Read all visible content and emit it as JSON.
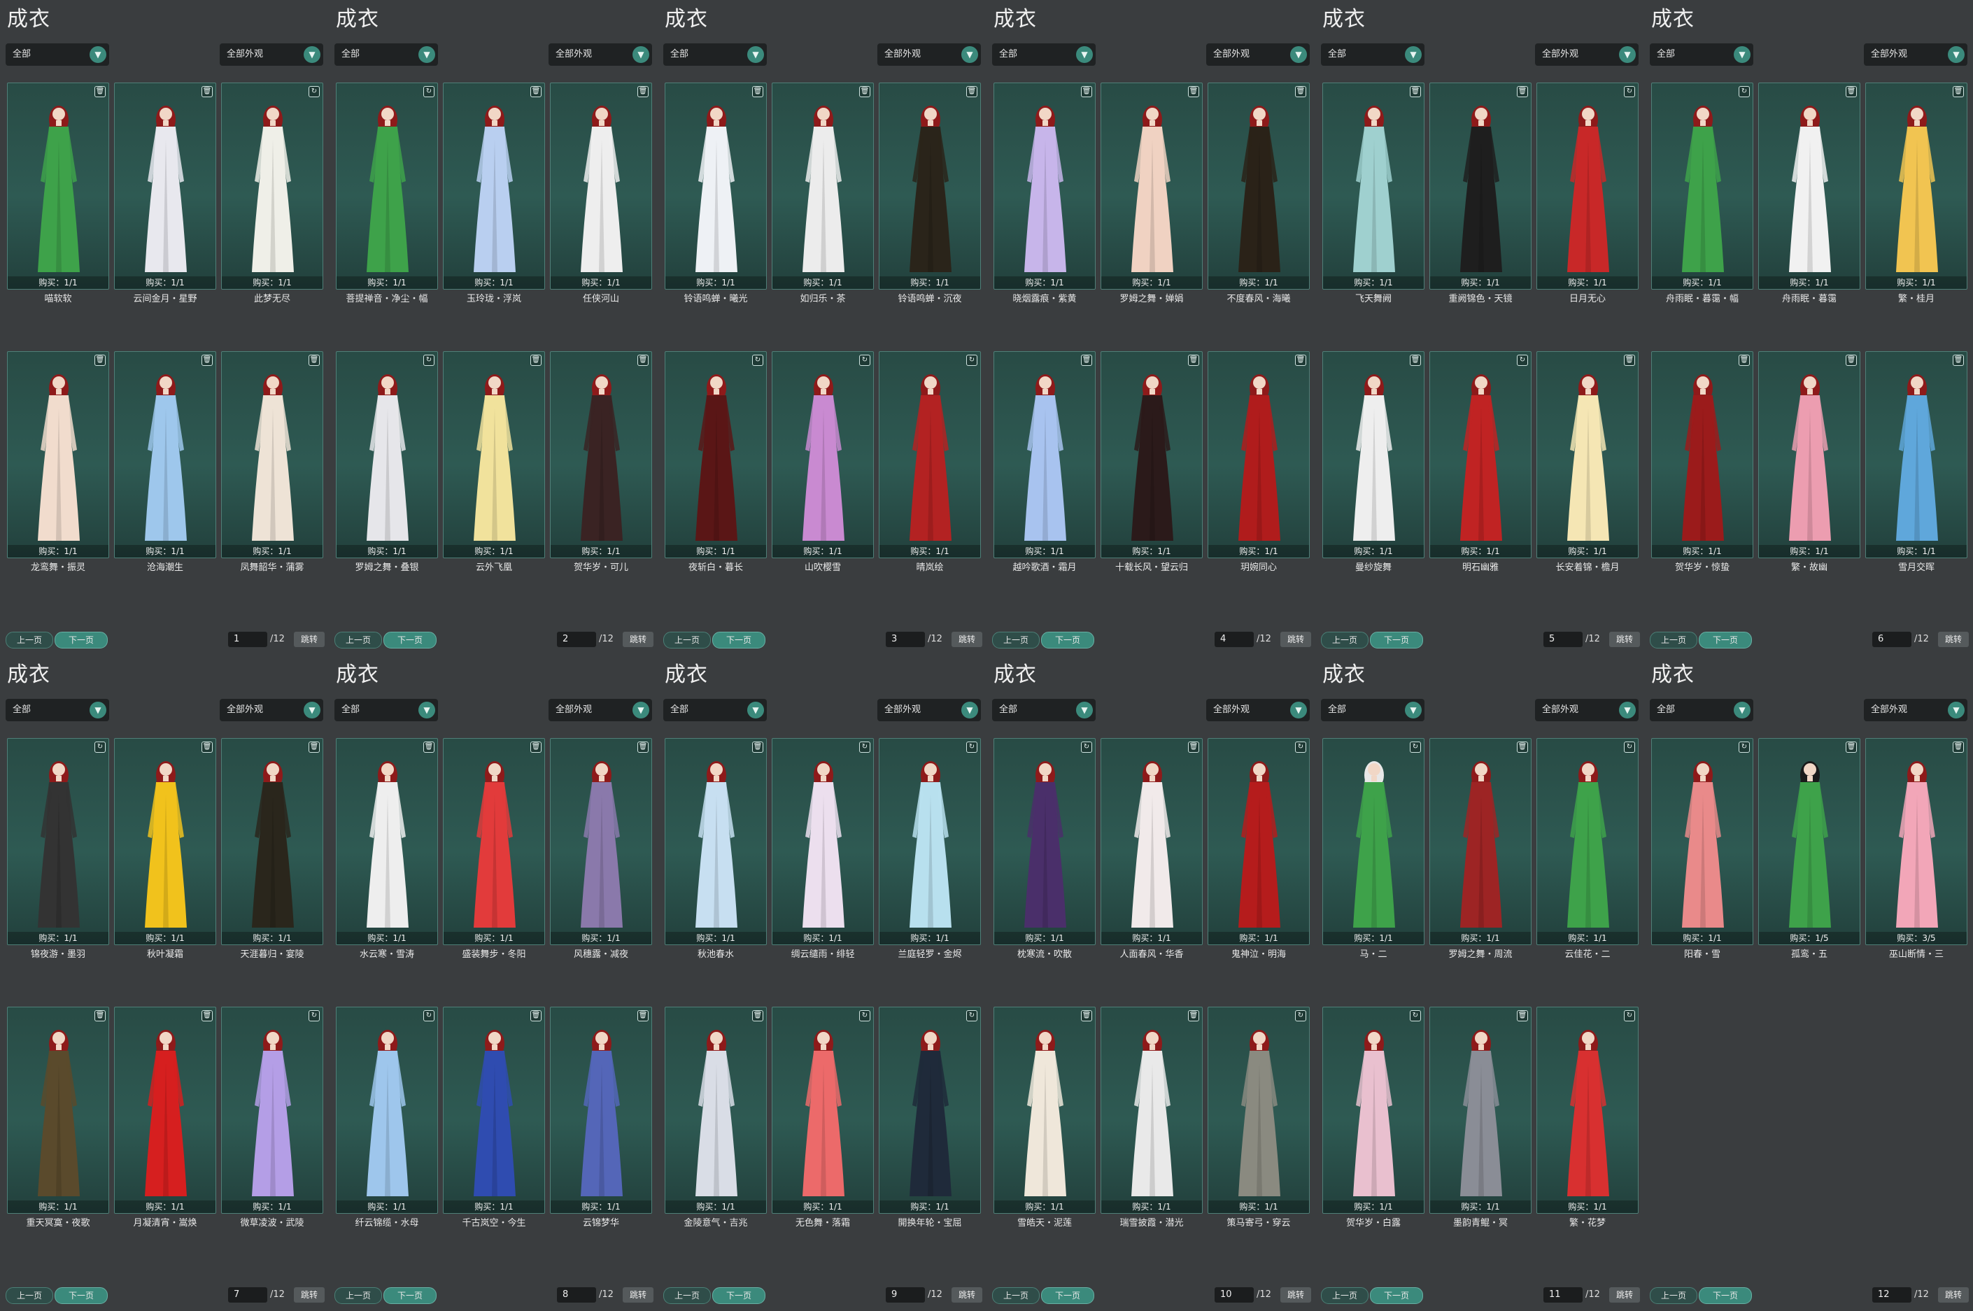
{
  "ui": {
    "title": "成衣",
    "filter_all": "全部",
    "filter_appearance": "全部外观",
    "prev": "上一页",
    "next": "下一页",
    "jump": "跳转",
    "total": "/12",
    "dropdown_icon": "chevron-down-icon"
  },
  "colors": {
    "panel_bg": "#3a3d3f",
    "card_bg": "#2e5a53",
    "accent": "#3b8a7c"
  },
  "pages": [
    {
      "page": "1",
      "items": [
        {
          "name": "喵软软",
          "buy": "购买：1/1",
          "icon": "trash-icon",
          "hair": "#8e1a1a",
          "outfit": "#3ea24a"
        },
        {
          "name": "云间金月・星野",
          "buy": "购买：1/1",
          "icon": "trash-icon",
          "hair": "#8e1a1a",
          "outfit": "#e8e8ee"
        },
        {
          "name": "此梦无尽",
          "buy": "购买：1/1",
          "icon": "refresh-icon",
          "hair": "#8e1a1a",
          "outfit": "#efefe8"
        },
        {
          "name": "龙鸾舞・振灵",
          "buy": "购买：1/1",
          "icon": "trash-icon",
          "hair": "#8e1a1a",
          "outfit": "#f1dccd"
        },
        {
          "name": "沧海潮生",
          "buy": "购买：1/1",
          "icon": "trash-icon",
          "hair": "#8e1a1a",
          "outfit": "#9ec7ec"
        },
        {
          "name": "凤舞韶华・蒲雾",
          "buy": "购买：1/1",
          "icon": "trash-icon",
          "hair": "#8e1a1a",
          "outfit": "#eee3d6"
        }
      ]
    },
    {
      "page": "2",
      "items": [
        {
          "name": "菩提禅音・净尘・幅",
          "buy": "购买：1/1",
          "icon": "refresh-icon",
          "hair": "#8e1a1a",
          "outfit": "#3ea24a"
        },
        {
          "name": "玉玲珑・浮岚",
          "buy": "购买：1/1",
          "icon": "trash-icon",
          "hair": "#8e1a1a",
          "outfit": "#b9cff0"
        },
        {
          "name": "任侠河山",
          "buy": "购买：1/1",
          "icon": "trash-icon",
          "hair": "#8e1a1a",
          "outfit": "#eeeeee"
        },
        {
          "name": "罗姆之舞・叠银",
          "buy": "购买：1/1",
          "icon": "refresh-icon",
          "hair": "#8e1a1a",
          "outfit": "#e6e6ea"
        },
        {
          "name": "云外飞凰",
          "buy": "购买：1/1",
          "icon": "trash-icon",
          "hair": "#8e1a1a",
          "outfit": "#f1e29c"
        },
        {
          "name": "贺华岁・可儿",
          "buy": "购买：1/1",
          "icon": "trash-icon",
          "hair": "#8e1a1a",
          "outfit": "#3a2323"
        }
      ]
    },
    {
      "page": "3",
      "items": [
        {
          "name": "铃语鸣蝉・曦光",
          "buy": "购买：1/1",
          "icon": "trash-icon",
          "hair": "#8e1a1a",
          "outfit": "#eef1f5"
        },
        {
          "name": "如归乐・茶",
          "buy": "购买：1/1",
          "icon": "trash-icon",
          "hair": "#8e1a1a",
          "outfit": "#ececec"
        },
        {
          "name": "铃语鸣蝉・沉夜",
          "buy": "购买：1/1",
          "icon": "trash-icon",
          "hair": "#8e1a1a",
          "outfit": "#2a241a"
        },
        {
          "name": "夜斩白・暮长",
          "buy": "购买：1/1",
          "icon": "refresh-icon",
          "hair": "#8e1a1a",
          "outfit": "#5a1616"
        },
        {
          "name": "山吹樱雪",
          "buy": "购买：1/1",
          "icon": "refresh-icon",
          "hair": "#8e1a1a",
          "outfit": "#c98ad1"
        },
        {
          "name": "晴岚绘",
          "buy": "购买：1/1",
          "icon": "refresh-icon",
          "hair": "#8e1a1a",
          "outfit": "#b32222"
        }
      ]
    },
    {
      "page": "4",
      "items": [
        {
          "name": "晓烟露痕・紫黄",
          "buy": "购买：1/1",
          "icon": "trash-icon",
          "hair": "#8e1a1a",
          "outfit": "#c7b5ea"
        },
        {
          "name": "罗姆之舞・婵娟",
          "buy": "购买：1/1",
          "icon": "trash-icon",
          "hair": "#8e1a1a",
          "outfit": "#f0d2c2"
        },
        {
          "name": "不度春风・海曦",
          "buy": "购买：1/1",
          "icon": "trash-icon",
          "hair": "#8e1a1a",
          "outfit": "#2a2218"
        },
        {
          "name": "越吟歌酒・霜月",
          "buy": "购买：1/1",
          "icon": "trash-icon",
          "hair": "#8e1a1a",
          "outfit": "#a8c3ef"
        },
        {
          "name": "十载长风・望云归",
          "buy": "购买：1/1",
          "icon": "trash-icon",
          "hair": "#8e1a1a",
          "outfit": "#2b1a1a"
        },
        {
          "name": "玥婉同心",
          "buy": "购买：1/1",
          "icon": "trash-icon",
          "hair": "#8e1a1a",
          "outfit": "#b01c1c"
        }
      ]
    },
    {
      "page": "5",
      "items": [
        {
          "name": "飞天舞阙",
          "buy": "购买：1/1",
          "icon": "trash-icon",
          "hair": "#8e1a1a",
          "outfit": "#9fd0cf"
        },
        {
          "name": "重阙锦色・天镜",
          "buy": "购买：1/1",
          "icon": "trash-icon",
          "hair": "#8e1a1a",
          "outfit": "#1e1e1e"
        },
        {
          "name": "日月无心",
          "buy": "购买：1/1",
          "icon": "refresh-icon",
          "hair": "#8e1a1a",
          "outfit": "#c82828"
        },
        {
          "name": "曼纱旋舞",
          "buy": "购买：1/1",
          "icon": "trash-icon",
          "hair": "#8e1a1a",
          "outfit": "#eeeeee"
        },
        {
          "name": "明石幽雅",
          "buy": "购买：1/1",
          "icon": "refresh-icon",
          "hair": "#8e1a1a",
          "outfit": "#c02323"
        },
        {
          "name": "长安着锦・檐月",
          "buy": "购买：1/1",
          "icon": "trash-icon",
          "hair": "#8e1a1a",
          "outfit": "#f5e6b4"
        }
      ]
    },
    {
      "page": "6",
      "items": [
        {
          "name": "舟雨眠・暮霭・幅",
          "buy": "购买：1/1",
          "icon": "refresh-icon",
          "hair": "#8e1a1a",
          "outfit": "#3ea24a"
        },
        {
          "name": "舟雨眠・暮霭",
          "buy": "购买：1/1",
          "icon": "trash-icon",
          "hair": "#8e1a1a",
          "outfit": "#f1f1f1"
        },
        {
          "name": "繁・桂月",
          "buy": "购买：1/1",
          "icon": "trash-icon",
          "hair": "#8e1a1a",
          "outfit": "#f1c451"
        },
        {
          "name": "贺华岁・惊蛰",
          "buy": "购买：1/1",
          "icon": "trash-icon",
          "hair": "#8e1a1a",
          "outfit": "#9b1b1b"
        },
        {
          "name": "繁・故幽",
          "buy": "购买：1/1",
          "icon": "trash-icon",
          "hair": "#8e1a1a",
          "outfit": "#ec9db0"
        },
        {
          "name": "雪月交晖",
          "buy": "购买：1/1",
          "icon": "trash-icon",
          "hair": "#8e1a1a",
          "outfit": "#5fa7db"
        }
      ]
    },
    {
      "page": "7",
      "items": [
        {
          "name": "锦夜游・墨羽",
          "buy": "购买：1/1",
          "icon": "refresh-icon",
          "hair": "#8e1a1a",
          "outfit": "#333333"
        },
        {
          "name": "秋叶凝霜",
          "buy": "购买：1/1",
          "icon": "trash-icon",
          "hair": "#8e1a1a",
          "outfit": "#f1c21c"
        },
        {
          "name": "天涯暮归・宴陵",
          "buy": "购买：1/1",
          "icon": "trash-icon",
          "hair": "#8e1a1a",
          "outfit": "#2a261c"
        },
        {
          "name": "重天冥寞・夜歌",
          "buy": "购买：1/1",
          "icon": "trash-icon",
          "hair": "#8e1a1a",
          "outfit": "#5a4a2c"
        },
        {
          "name": "月凝清宵・嵩焕",
          "buy": "购买：1/1",
          "icon": "trash-icon",
          "hair": "#8e1a1a",
          "outfit": "#d61f1f"
        },
        {
          "name": "微草凌波・武陵",
          "buy": "购买：1/1",
          "icon": "refresh-icon",
          "hair": "#8e1a1a",
          "outfit": "#b49ee6"
        }
      ]
    },
    {
      "page": "8",
      "items": [
        {
          "name": "水云寒・雪涛",
          "buy": "购买：1/1",
          "icon": "trash-icon",
          "hair": "#8e1a1a",
          "outfit": "#eeeeee"
        },
        {
          "name": "盛装舞步・冬阳",
          "buy": "购买：1/1",
          "icon": "trash-icon",
          "hair": "#8e1a1a",
          "outfit": "#e23b3b"
        },
        {
          "name": "风穗露・减夜",
          "buy": "购买：1/1",
          "icon": "trash-icon",
          "hair": "#8e1a1a",
          "outfit": "#8a79ab"
        },
        {
          "name": "纤云锦缆・水母",
          "buy": "购买：1/1",
          "icon": "refresh-icon",
          "hair": "#8e1a1a",
          "outfit": "#9ec6ec"
        },
        {
          "name": "千古岚空・今生",
          "buy": "购买：1/1",
          "icon": "trash-icon",
          "hair": "#8e1a1a",
          "outfit": "#2f4cb0"
        },
        {
          "name": "云锦梦华",
          "buy": "购买：1/1",
          "icon": "trash-icon",
          "hair": "#8e1a1a",
          "outfit": "#5466b8"
        }
      ]
    },
    {
      "page": "9",
      "items": [
        {
          "name": "秋池春水",
          "buy": "购买：1/1",
          "icon": "trash-icon",
          "hair": "#8e1a1a",
          "outfit": "#c7dff1"
        },
        {
          "name": "绸云缱雨・绯轻",
          "buy": "购买：1/1",
          "icon": "refresh-icon",
          "hair": "#8e1a1a",
          "outfit": "#ecdfee"
        },
        {
          "name": "兰庭轻罗・金烬",
          "buy": "购买：1/1",
          "icon": "refresh-icon",
          "hair": "#8e1a1a",
          "outfit": "#b8e0ee"
        },
        {
          "name": "金陵意气・吉兆",
          "buy": "购买：1/1",
          "icon": "trash-icon",
          "hair": "#8e1a1a",
          "outfit": "#d9dde6"
        },
        {
          "name": "无色舞・落霜",
          "buy": "购买：1/1",
          "icon": "refresh-icon",
          "hair": "#8e1a1a",
          "outfit": "#ec6a6a"
        },
        {
          "name": "開换年轮・宝屈",
          "buy": "购买：1/1",
          "icon": "refresh-icon",
          "hair": "#8e1a1a",
          "outfit": "#1f2a3a"
        }
      ]
    },
    {
      "page": "10",
      "items": [
        {
          "name": "枕寒流・吹散",
          "buy": "购买：1/1",
          "icon": "refresh-icon",
          "hair": "#8e1a1a",
          "outfit": "#4a2f6a"
        },
        {
          "name": "人面春风・华香",
          "buy": "购买：1/1",
          "icon": "trash-icon",
          "hair": "#8e1a1a",
          "outfit": "#f1eaea"
        },
        {
          "name": "鬼神泣・明海",
          "buy": "购买：1/1",
          "icon": "refresh-icon",
          "hair": "#8e1a1a",
          "outfit": "#b51c1c"
        },
        {
          "name": "雪皓天・泥莲",
          "buy": "购买：1/1",
          "icon": "trash-icon",
          "hair": "#8e1a1a",
          "outfit": "#efe7da"
        },
        {
          "name": "瑞雪披霞・潜光",
          "buy": "购买：1/1",
          "icon": "trash-icon",
          "hair": "#8e1a1a",
          "outfit": "#e9e9e9"
        },
        {
          "name": "策马寄弓・穿云",
          "buy": "购买：1/1",
          "icon": "refresh-icon",
          "hair": "#8e1a1a",
          "outfit": "#8a8a80"
        }
      ]
    },
    {
      "page": "11",
      "items": [
        {
          "name": "马・二",
          "buy": "购买：1/1",
          "icon": "refresh-icon",
          "hair": "#e8e8e8",
          "outfit": "#3ea24a"
        },
        {
          "name": "罗姆之舞・周流",
          "buy": "购买：1/1",
          "icon": "trash-icon",
          "hair": "#8e1a1a",
          "outfit": "#9d2424"
        },
        {
          "name": "云佳花・二",
          "buy": "购买：1/1",
          "icon": "refresh-icon",
          "hair": "#8e1a1a",
          "outfit": "#3ea24a"
        },
        {
          "name": "贺华岁・白露",
          "buy": "购买：1/1",
          "icon": "refresh-icon",
          "hair": "#8e1a1a",
          "outfit": "#e9c0cf"
        },
        {
          "name": "墨韵青鲲・冥",
          "buy": "购买：1/1",
          "icon": "trash-icon",
          "hair": "#8e1a1a",
          "outfit": "#8a8d96"
        },
        {
          "name": "繁・花梦",
          "buy": "购买：1/1",
          "icon": "refresh-icon",
          "hair": "#8e1a1a",
          "outfit": "#d83030"
        }
      ]
    },
    {
      "page": "12",
      "items": [
        {
          "name": "阳春・雪",
          "buy": "购买：1/1",
          "icon": "refresh-icon",
          "hair": "#8e1a1a",
          "outfit": "#e98a8a"
        },
        {
          "name": "孤鸾・五",
          "buy": "购买：1/5",
          "icon": "trash-icon",
          "hair": "#1a1a1a",
          "outfit": "#3ea24a"
        },
        {
          "name": "巫山断情・三",
          "buy": "购买：3/5",
          "icon": "trash-icon",
          "hair": "#8e1a1a",
          "outfit": "#f2a6b8"
        }
      ]
    }
  ]
}
